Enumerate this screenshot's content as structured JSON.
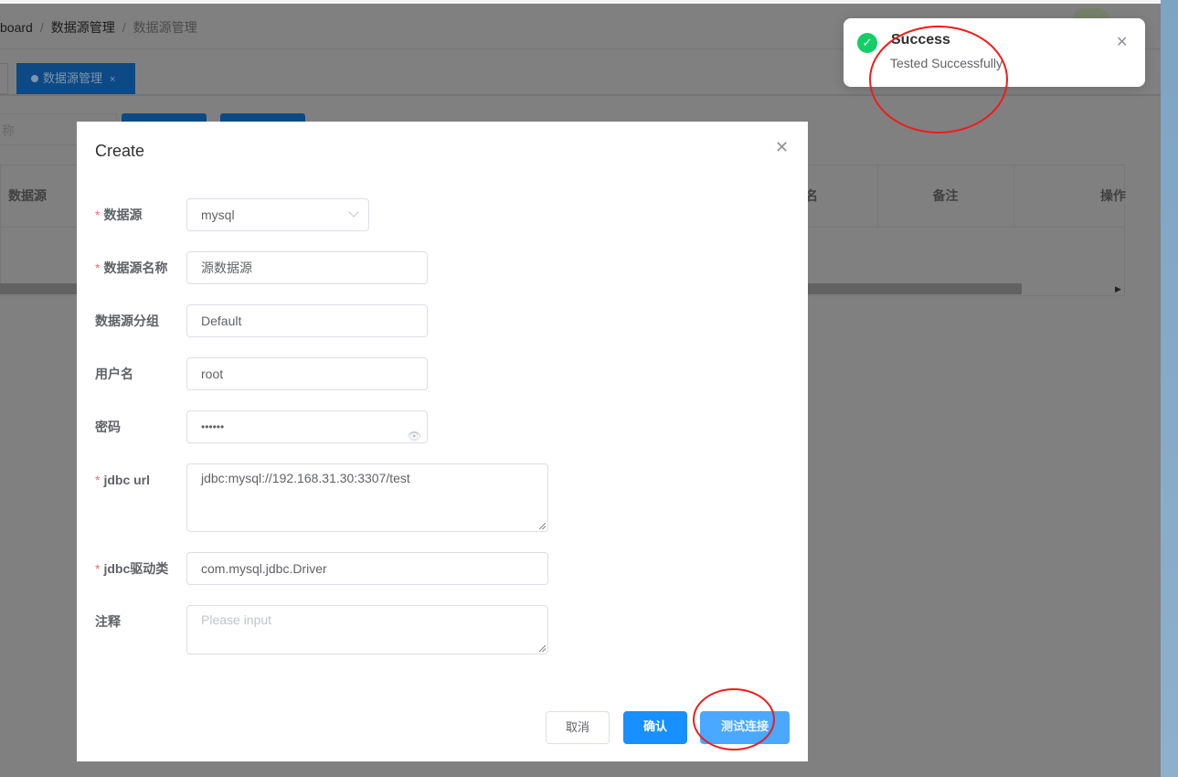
{
  "breadcrumb": [
    "board",
    "数据源管理",
    "数据源管理"
  ],
  "tabs": [
    {
      "label": "数据源管理",
      "active": true
    }
  ],
  "search": {
    "placeholder": "称"
  },
  "table": {
    "headers": [
      "数据源",
      "名",
      "备注",
      "操作"
    ]
  },
  "dialog": {
    "title": "Create",
    "fields": [
      {
        "label": "数据源",
        "required": true,
        "value": "mysql",
        "type": "select"
      },
      {
        "label": "数据源名称",
        "required": true,
        "value": "源数据源"
      },
      {
        "label": "数据源分组",
        "required": false,
        "value": "Default"
      },
      {
        "label": "用户名",
        "required": false,
        "value": "root"
      },
      {
        "label": "密码",
        "required": false,
        "value": "••••••",
        "type": "password"
      },
      {
        "label": "jdbc url",
        "required": true,
        "value": "jdbc:mysql://192.168.31.30:3307/test",
        "type": "textarea"
      },
      {
        "label": "jdbc驱动类",
        "required": true,
        "value": "com.mysql.jdbc.Driver"
      },
      {
        "label": "注释",
        "required": false,
        "value": "",
        "placeholder": "Please input",
        "type": "textarea"
      }
    ],
    "buttons": {
      "cancel": "取消",
      "confirm": "确认",
      "test": "测试连接"
    }
  },
  "toast": {
    "title": "Success",
    "message": "Tested Successfully",
    "type": "success",
    "icon": "check-circle-icon"
  },
  "colors": {
    "primary": "#1890ff",
    "success": "#13ce66",
    "annotation": "#ee1c1c"
  }
}
